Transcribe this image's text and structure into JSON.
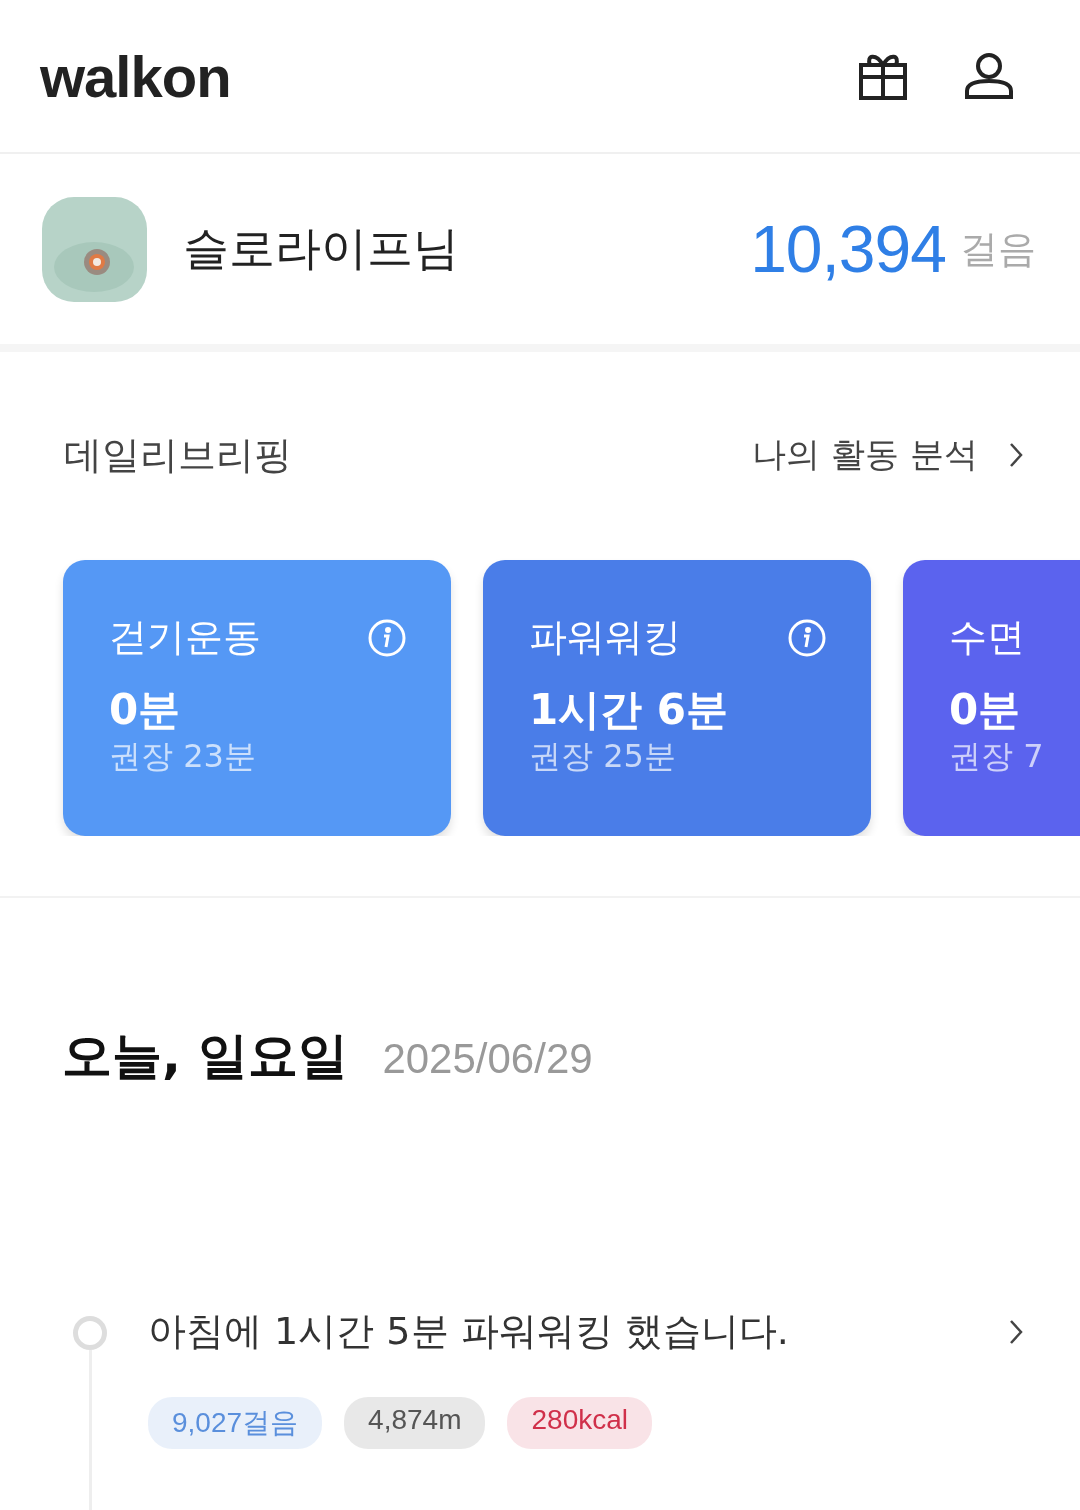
{
  "header": {
    "logo": "walkon"
  },
  "profile": {
    "name": "슬로라이프님",
    "steps": "10,394",
    "steps_unit": "걸음"
  },
  "briefing": {
    "title": "데일리브리핑",
    "link": "나의 활동 분석",
    "cards": [
      {
        "title": "걷기운동",
        "value": "0분",
        "recommended": "권장 23분",
        "color": "#5598f5",
        "info_icon": true
      },
      {
        "title": "파워워킹",
        "value": "1시간 6분",
        "recommended": "권장 25분",
        "color": "#4a7de8",
        "info_icon": true
      },
      {
        "title": "수면",
        "value": "0분",
        "recommended": "권장 7",
        "color": "#5b63ee",
        "info_icon": false
      }
    ]
  },
  "today": {
    "title": "오늘, 일요일",
    "date": "2025/06/29"
  },
  "timeline": [
    {
      "text": "아침에 1시간 5분 파워워킹 했습니다.",
      "tags": [
        {
          "text": "9,027걸음",
          "color": "#5a8fdc"
        },
        {
          "text": "4,874m",
          "color": "#555555"
        },
        {
          "text": "280kcal",
          "color": "#d0304a"
        }
      ]
    }
  ]
}
